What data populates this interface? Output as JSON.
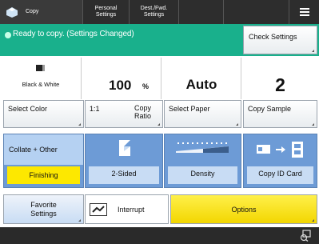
{
  "topbar": {
    "copy_label": "Copy",
    "personal_label": "Personal Settings",
    "personal_line1": "Personal",
    "personal_line2": "Settings",
    "dest_line1": "Dest./Fwd.",
    "dest_line2": "Settings"
  },
  "status": {
    "message": "Ready to copy. (Settings Changed)",
    "check_settings": "Check Settings"
  },
  "info": {
    "color_mode": "Black & White",
    "ratio_value": "100",
    "ratio_unit": "%",
    "paper": "Auto",
    "quantity": "2"
  },
  "settings": {
    "select_color": "Select Color",
    "ratio_prefix": "1:1",
    "copy_ratio_line1": "Copy",
    "copy_ratio_line2": "Ratio",
    "select_paper": "Select Paper",
    "copy_sample": "Copy Sample"
  },
  "functions": {
    "collate_other": "Collate + Other",
    "finishing": "Finishing",
    "two_sided": "2-Sided",
    "density": "Density",
    "copy_id_card": "Copy ID Card"
  },
  "bottom": {
    "favorite_line1": "Favorite",
    "favorite_line2": "Settings",
    "interrupt": "Interrupt",
    "options": "Options"
  },
  "colors": {
    "topbar": "#2d2d2d",
    "status": "#19b08c",
    "tile_blue": "#6d9bd6",
    "highlight_yellow": "#fde800"
  },
  "icons": [
    "copy-icon",
    "menu-icon",
    "status-dot-icon",
    "bw-icon",
    "two-sided-icon",
    "density-icon",
    "id-card-icon",
    "interrupt-icon",
    "counter-check-icon"
  ]
}
